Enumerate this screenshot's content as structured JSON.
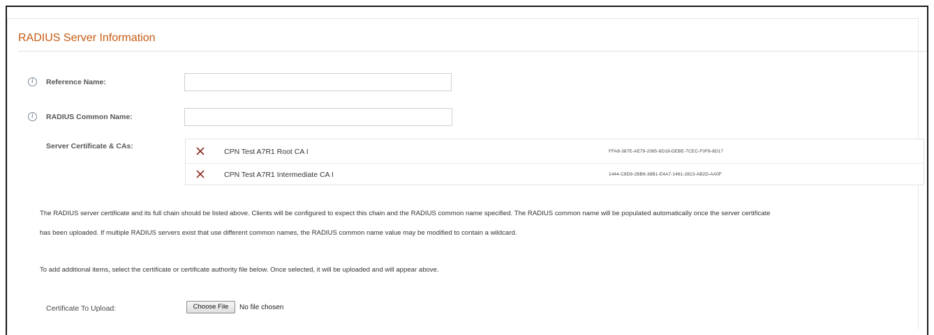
{
  "section": {
    "title": "RADIUS Server Information"
  },
  "fields": {
    "reference_name": {
      "label": "Reference Name:",
      "value": ""
    },
    "common_name": {
      "label": "RADIUS Common Name:",
      "value": ""
    },
    "server_certs": {
      "label": "Server Certificate & CAs:"
    }
  },
  "certificates": [
    {
      "name": "CPN Test A7R1 Root CA I",
      "id": "FFA8-387E-AE79-2085-8D18-DEBE-7CEC-F0F8-8D17"
    },
    {
      "name": "CPN Test A7R1 Intermediate CA I",
      "id": "1444-C8D9-2BB6-38B1-E4A7-1461-2823-AB2D-AA0F"
    }
  ],
  "help_text": {
    "line1": "The RADIUS server certificate and its full chain should be listed above. Clients will be configured to expect this chain and the RADIUS common name specified. The RADIUS common name will be populated automatically once the server certificate",
    "line2": "has been uploaded. If multiple RADIUS servers exist that use different common names, the RADIUS common name value may be modified to contain a wildcard.",
    "line3": "To add additional items, select the certificate or certificate authority file below. Once selected, it will be uploaded and will appear above."
  },
  "upload": {
    "label": "Certificate To Upload:",
    "button": "Choose File",
    "status": "No file chosen"
  },
  "colors": {
    "section_title": "#c55a11",
    "remove_icon": "#8b2a1e",
    "frame_border": "#1a1a1a"
  },
  "icons": {
    "info": "info-icon",
    "remove": "close-x-icon"
  }
}
